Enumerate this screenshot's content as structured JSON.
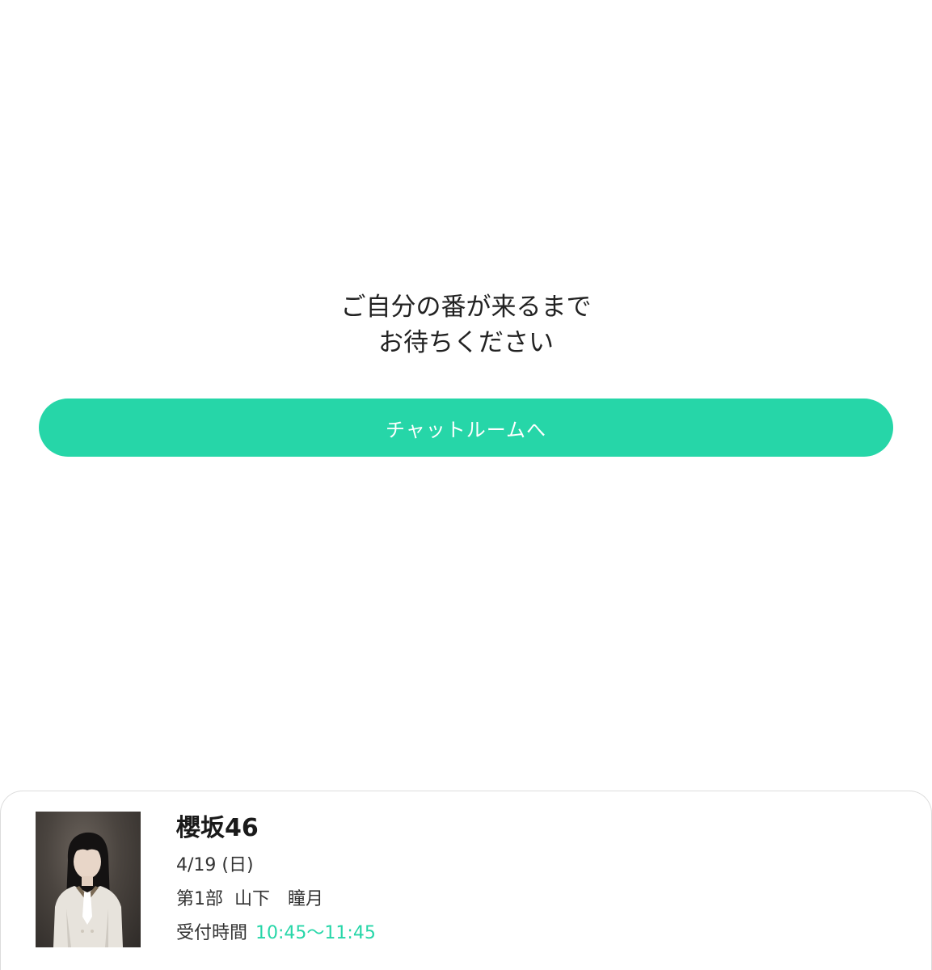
{
  "waiting": {
    "line1": "ご自分の番が来るまで",
    "line2": "お待ちください"
  },
  "chat_button": {
    "label": "チャットルームへ"
  },
  "ticket": {
    "group_name": "櫻坂46",
    "date": "4/19 (日)",
    "session": "第1部  山下　瞳月",
    "reception_label": "受付時間",
    "reception_time": "10:45〜11:45"
  },
  "colors": {
    "accent": "#26d6a8",
    "text": "#222222",
    "background": "#ffffff"
  }
}
